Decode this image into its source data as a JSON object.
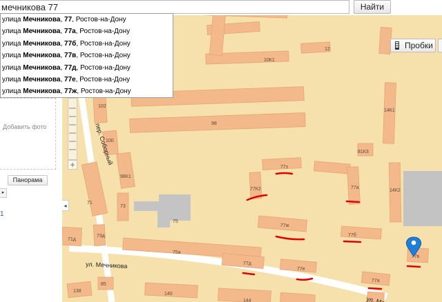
{
  "search": {
    "value": "мечникова 77",
    "button_label": "Найти"
  },
  "suggestions": [
    {
      "prefix": "улица ",
      "bold": "Мечникова",
      "mid": ", ",
      "bold2": "77",
      "suffix": ", Ростов-на-Дону"
    },
    {
      "prefix": "улица ",
      "bold": "Мечникова",
      "mid": ", ",
      "bold2": "77а",
      "suffix": ", Ростов-на-Дону"
    },
    {
      "prefix": "улица ",
      "bold": "Мечникова",
      "mid": ", ",
      "bold2": "77б",
      "suffix": ", Ростов-на-Дону"
    },
    {
      "prefix": "улица ",
      "bold": "Мечникова",
      "mid": ", ",
      "bold2": "77в",
      "suffix": ", Ростов-на-Дону"
    },
    {
      "prefix": "улица ",
      "bold": "Мечникова",
      "mid": ", ",
      "bold2": "77д",
      "suffix": ", Ростов-на-Дону"
    },
    {
      "prefix": "улица ",
      "bold": "Мечникова",
      "mid": ", ",
      "bold2": "77е",
      "suffix": ", Ростов-на-Дону"
    },
    {
      "prefix": "улица ",
      "bold": "Мечникова",
      "mid": ", ",
      "bold2": "77ж",
      "suffix": ", Ростов-на-Дону"
    }
  ],
  "left_panel": {
    "add_photo": "Добавить фото",
    "panorama": "Панорама",
    "side_number": "1"
  },
  "traffic": {
    "label": "Пробки"
  },
  "colors": {
    "background": "#f6e0ab",
    "building": "#f3b98a",
    "building_stroke": "#e4a577",
    "road": "#ffffff",
    "gray_building": "#c2c2c2",
    "marker": "#1f7fd6",
    "annotation": "#dd0000"
  },
  "map": {
    "streets": [
      "ул. Мечникова",
      "ул. Мечникова",
      "пер. Соборный"
    ],
    "building_labels": [
      "10К1",
      "12",
      "102",
      "14К1",
      "98",
      "100",
      "81К3",
      "77з",
      "98К1",
      "77К2",
      "77а",
      "14К2",
      "71",
      "73",
      "75",
      "77ж",
      "77б",
      "71д",
      "73д",
      "75а",
      "77д",
      "77е",
      "77в",
      "77а",
      "138",
      "85",
      "140",
      "144"
    ],
    "marker": "geo-pin"
  }
}
